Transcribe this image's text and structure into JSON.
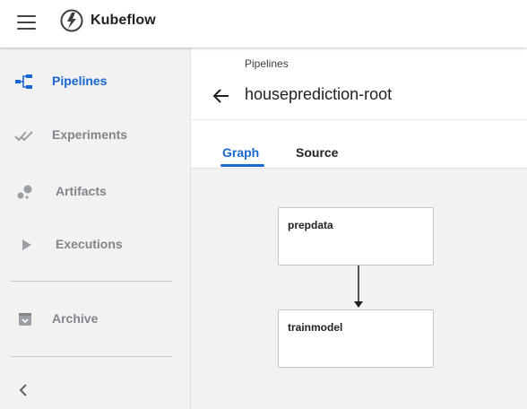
{
  "app": {
    "brand": "Kubeflow"
  },
  "sidebar": {
    "items": [
      {
        "label": "Pipelines",
        "icon": "pipelines-icon",
        "active": true
      },
      {
        "label": "Experiments",
        "icon": "experiments-icon",
        "active": false
      },
      {
        "label": "Artifacts",
        "icon": "artifacts-icon",
        "active": false
      },
      {
        "label": "Executions",
        "icon": "executions-icon",
        "active": false
      },
      {
        "label": "Archive",
        "icon": "archive-icon",
        "active": false
      }
    ]
  },
  "header": {
    "breadcrumb": "Pipelines",
    "title": "houseprediction-root"
  },
  "tabs": [
    {
      "label": "Graph",
      "active": true
    },
    {
      "label": "Source",
      "active": false
    }
  ],
  "graph": {
    "nodes": [
      {
        "label": "prepdata"
      },
      {
        "label": "trainmodel"
      }
    ],
    "edges": [
      {
        "from": "prepdata",
        "to": "trainmodel"
      }
    ]
  },
  "colors": {
    "accent": "#1967d2",
    "sidebar_bg": "#f2f2f2",
    "canvas_bg": "#f2f2f2",
    "inactive_nav": "#80868b"
  }
}
